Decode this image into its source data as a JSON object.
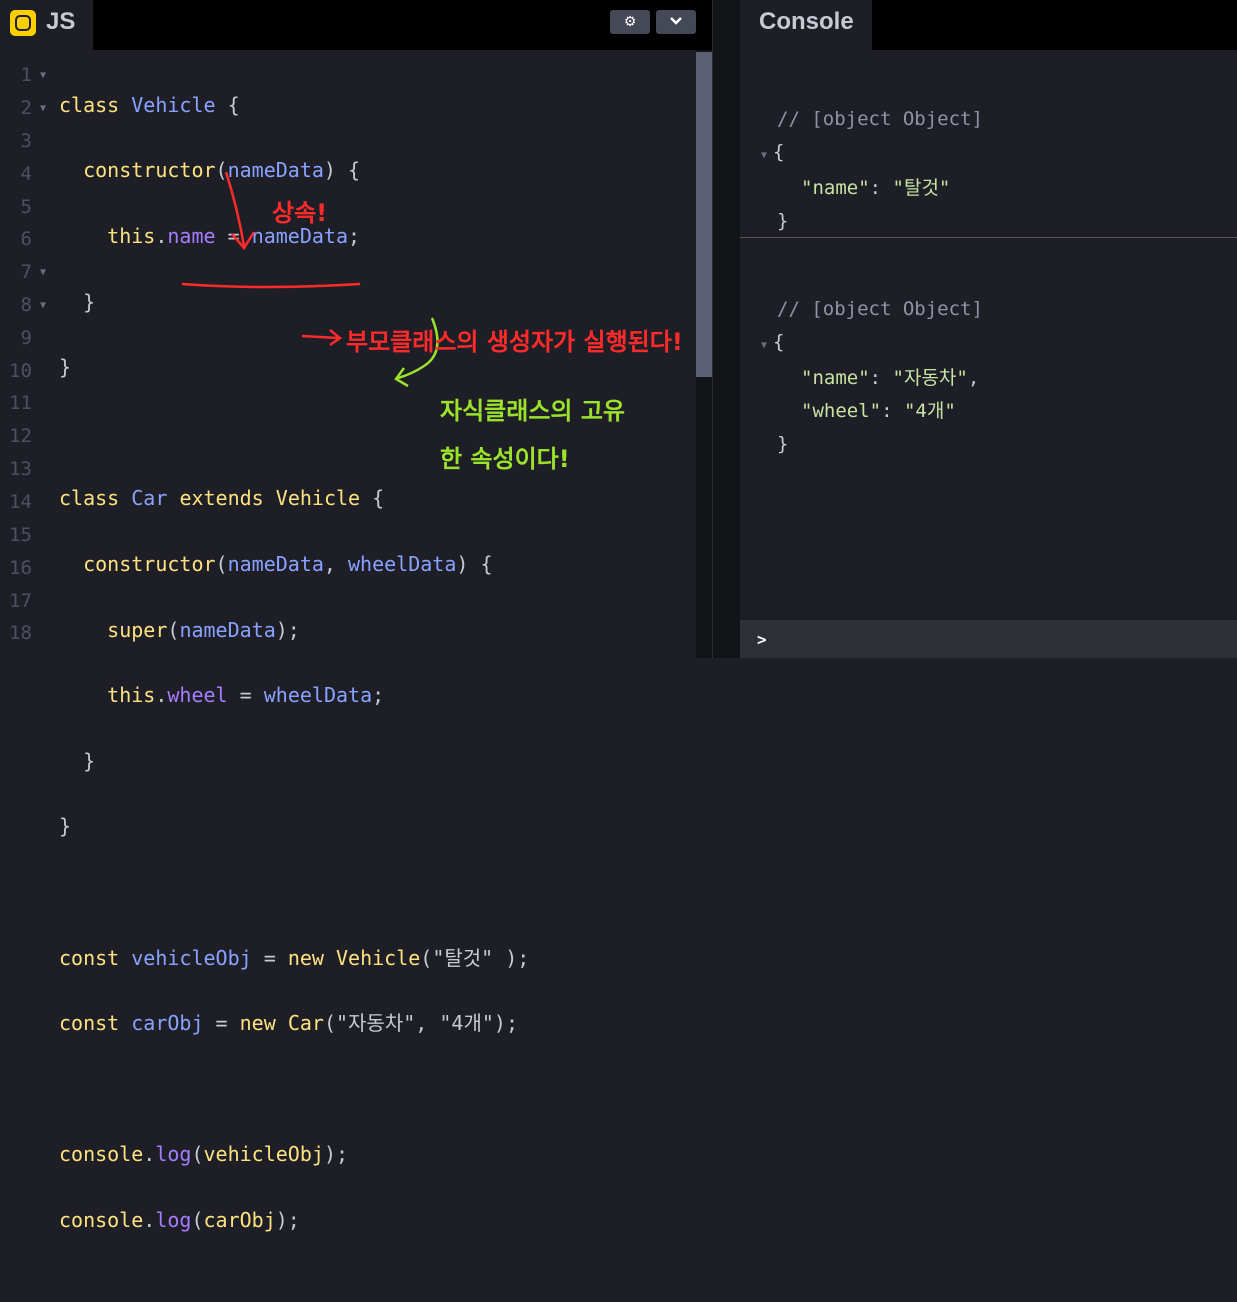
{
  "editor": {
    "tab_label": "JS",
    "settings_icon": "gear-icon",
    "collapse_icon": "chevron-down-icon",
    "line_numbers": [
      "1",
      "2",
      "3",
      "4",
      "5",
      "6",
      "7",
      "8",
      "9",
      "10",
      "11",
      "12",
      "13",
      "14",
      "15",
      "16",
      "17",
      "18"
    ],
    "code": {
      "l1": {
        "kw": "class",
        "name": "Vehicle",
        "rest": " {"
      },
      "l2": {
        "name": "constructor",
        "open": "(",
        "arg": "nameData",
        "close": ") {"
      },
      "l3": {
        "kw": "this",
        "dot": ".",
        "prop": "name",
        "eq": " = ",
        "val": "nameData",
        "semi": ";"
      },
      "l4": "}",
      "l5": "}",
      "l7": {
        "kw": "class",
        "name": "Car",
        "ext": "extends",
        "parent": "Vehicle",
        "rest": " {"
      },
      "l8": {
        "name": "constructor",
        "open": "(",
        "arg1": "nameData",
        "comma": ", ",
        "arg2": "wheelData",
        "close": ") {"
      },
      "l9": {
        "kw": "super",
        "open": "(",
        "arg": "nameData",
        "close": ");"
      },
      "l10": {
        "kw": "this",
        "dot": ".",
        "prop": "wheel",
        "eq": " = ",
        "val": "wheelData",
        "semi": ";"
      },
      "l11": "}",
      "l12": "}",
      "l14": {
        "kw": "const",
        "name": "vehicleObj",
        "eq": " = ",
        "new": "new",
        "cls": "Vehicle",
        "open": "(",
        "str": "\"탈것\"",
        "close": " );"
      },
      "l15": {
        "kw": "const",
        "name": "carObj",
        "eq": " = ",
        "new": "new",
        "cls": "Car",
        "open": "(",
        "str1": "\"자동차\"",
        "comma": ", ",
        "str2": "\"4개\"",
        "close": ");"
      },
      "l17": {
        "obj": "console",
        "dot": ".",
        "fn": "log",
        "open": "(",
        "arg": "vehicleObj",
        "close": ");"
      },
      "l18": {
        "obj": "console",
        "dot": ".",
        "fn": "log",
        "open": "(",
        "arg": "carObj",
        "close": ");"
      }
    }
  },
  "console": {
    "tab_label": "Console",
    "entries": [
      {
        "comment": "// [object Object]",
        "open": "{",
        "lines": [
          {
            "key": "\"name\"",
            "colon": ": ",
            "val": "\"탈것\"",
            "trail": ""
          }
        ],
        "closeb": "}"
      },
      {
        "comment": "// [object Object]",
        "open": "{",
        "lines": [
          {
            "key": "\"name\"",
            "colon": ": ",
            "val": "\"자동차\"",
            "trail": ","
          },
          {
            "key": "\"wheel\"",
            "colon": ": ",
            "val": "\"4개\"",
            "trail": ""
          }
        ],
        "closeb": "}"
      }
    ],
    "prompt": ">"
  },
  "annotations": {
    "inherit": "상속!",
    "parent_ctor": "부모클래스의 생성자가 실행된다!",
    "child_prop_1": "자식클래스의 고유",
    "child_prop_2": "한 속성이다!"
  },
  "colors": {
    "red": "#ff2a2a",
    "green": "#9be22a",
    "js_badge": "#fcd000"
  }
}
